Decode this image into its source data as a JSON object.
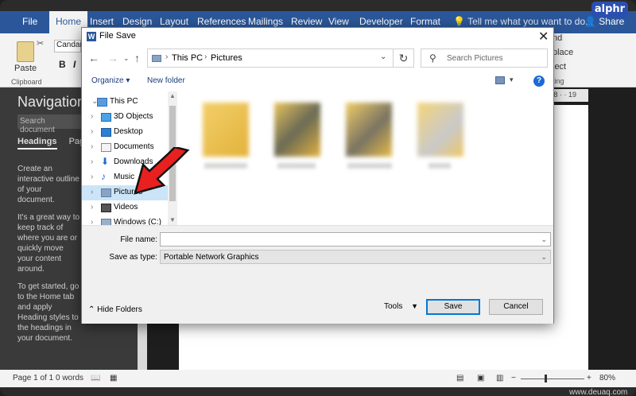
{
  "word": {
    "tabs": [
      "File",
      "Home",
      "Insert",
      "Design",
      "Layout",
      "References",
      "Mailings",
      "Review",
      "View",
      "Developer",
      "Format"
    ],
    "active_tab": "Home",
    "tell_me": "Tell me what you want to do...",
    "share": "Share",
    "paste": "Paste",
    "clipboard": "Clipboard",
    "font": "Candar",
    "bold": "B",
    "italic": "I",
    "underline": "U",
    "right_side": [
      "nd",
      "place",
      "lect",
      "ting"
    ],
    "ruler": "· 18 · · 19",
    "nav": {
      "title": "Navigation",
      "search_placeholder": "Search document",
      "tabs": [
        "Headings",
        "Pages"
      ],
      "text": [
        "Create an interactive outline of your document.",
        "It's a great way to keep track of where you are or quickly move your content around.",
        "To get started, go to the Home tab and apply Heading styles to the headings in your document."
      ]
    },
    "status": {
      "page": "Page 1 of 1",
      "words": "0 words",
      "zoom": "80%",
      "zoom_level": 0.4
    },
    "watermark": "www.deuaq.com",
    "brand": "alphr"
  },
  "dialog": {
    "title": "File Save",
    "breadcrumb": [
      "This PC",
      "Pictures"
    ],
    "search_placeholder": "Search Pictures",
    "organize": "Organize ▾",
    "new_folder": "New folder",
    "tree": [
      {
        "label": "This PC",
        "icon": "pc-icon",
        "expanded": true
      },
      {
        "label": "3D Objects",
        "icon": "cube-icon"
      },
      {
        "label": "Desktop",
        "icon": "desktop-icon"
      },
      {
        "label": "Documents",
        "icon": "document-icon"
      },
      {
        "label": "Downloads",
        "icon": "download-icon"
      },
      {
        "label": "Music",
        "icon": "music-icon"
      },
      {
        "label": "Pictures",
        "icon": "pictures-icon",
        "selected": true
      },
      {
        "label": "Videos",
        "icon": "video-icon"
      },
      {
        "label": "Windows (C:)",
        "icon": "drive-icon"
      }
    ],
    "file_name_label": "File name:",
    "file_name_value": "",
    "save_type_label": "Save as type:",
    "save_type_value": "Portable Network Graphics",
    "hide_folders": "Hide Folders",
    "tools": "Tools",
    "save": "Save",
    "cancel": "Cancel"
  },
  "colors": {
    "word_blue": "#2b579a",
    "selection": "#cce4f7",
    "arrow_red": "#e8201f"
  }
}
